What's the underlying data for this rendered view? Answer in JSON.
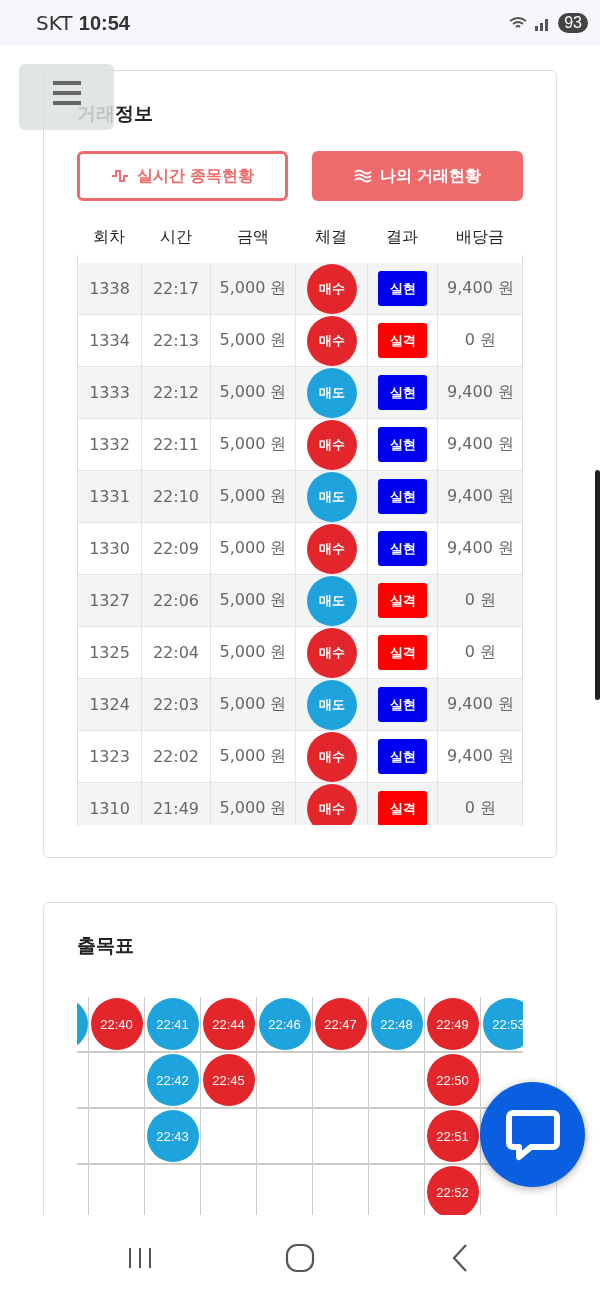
{
  "status_bar": {
    "carrier": "SKT",
    "time": "10:54",
    "battery": "93"
  },
  "trade_card": {
    "title": "거래정보",
    "tabs": [
      {
        "label": "실시간 종목현황",
        "selected": false
      },
      {
        "label": "나의 거래현황",
        "selected": true
      }
    ],
    "columns": [
      "회차",
      "시간",
      "금액",
      "체결",
      "결과",
      "배당금"
    ],
    "rows": [
      {
        "round": "1338",
        "time": "22:17",
        "amount": "5,000 원",
        "side": {
          "label": "매수",
          "color": "#e3262b"
        },
        "result": {
          "label": "실현",
          "color": "#0000f0"
        },
        "payout": "9,400 원"
      },
      {
        "round": "1334",
        "time": "22:13",
        "amount": "5,000 원",
        "side": {
          "label": "매수",
          "color": "#e3262b"
        },
        "result": {
          "label": "실격",
          "color": "#ff0000"
        },
        "payout": "0 원"
      },
      {
        "round": "1333",
        "time": "22:12",
        "amount": "5,000 원",
        "side": {
          "label": "매도",
          "color": "#1fa3dc"
        },
        "result": {
          "label": "실현",
          "color": "#0000f0"
        },
        "payout": "9,400 원"
      },
      {
        "round": "1332",
        "time": "22:11",
        "amount": "5,000 원",
        "side": {
          "label": "매수",
          "color": "#e3262b"
        },
        "result": {
          "label": "실현",
          "color": "#0000f0"
        },
        "payout": "9,400 원"
      },
      {
        "round": "1331",
        "time": "22:10",
        "amount": "5,000 원",
        "side": {
          "label": "매도",
          "color": "#1fa3dc"
        },
        "result": {
          "label": "실현",
          "color": "#0000f0"
        },
        "payout": "9,400 원"
      },
      {
        "round": "1330",
        "time": "22:09",
        "amount": "5,000 원",
        "side": {
          "label": "매수",
          "color": "#e3262b"
        },
        "result": {
          "label": "실현",
          "color": "#0000f0"
        },
        "payout": "9,400 원"
      },
      {
        "round": "1327",
        "time": "22:06",
        "amount": "5,000 원",
        "side": {
          "label": "매도",
          "color": "#1fa3dc"
        },
        "result": {
          "label": "실격",
          "color": "#ff0000"
        },
        "payout": "0 원"
      },
      {
        "round": "1325",
        "time": "22:04",
        "amount": "5,000 원",
        "side": {
          "label": "매수",
          "color": "#e3262b"
        },
        "result": {
          "label": "실격",
          "color": "#ff0000"
        },
        "payout": "0 원"
      },
      {
        "round": "1324",
        "time": "22:03",
        "amount": "5,000 원",
        "side": {
          "label": "매도",
          "color": "#1fa3dc"
        },
        "result": {
          "label": "실현",
          "color": "#0000f0"
        },
        "payout": "9,400 원"
      },
      {
        "round": "1323",
        "time": "22:02",
        "amount": "5,000 원",
        "side": {
          "label": "매수",
          "color": "#e3262b"
        },
        "result": {
          "label": "실현",
          "color": "#0000f0"
        },
        "payout": "9,400 원"
      },
      {
        "round": "1310",
        "time": "21:49",
        "amount": "5,000 원",
        "side": {
          "label": "매수",
          "color": "#e3262b"
        },
        "result": {
          "label": "실격",
          "color": "#ff0000"
        },
        "payout": "0 원"
      }
    ]
  },
  "board_card": {
    "title": "출목표",
    "columns": [
      {
        "marks": [
          {
            "color": "#1fa3dc"
          }
        ]
      },
      {
        "marks": [
          {
            "color": "#e3262b",
            "time": "22:40"
          }
        ]
      },
      {
        "marks": [
          {
            "color": "#1fa3dc",
            "time": "22:41"
          },
          {
            "color": "#1fa3dc",
            "time": "22:42"
          },
          {
            "color": "#1fa3dc",
            "time": "22:43"
          }
        ]
      },
      {
        "marks": [
          {
            "color": "#e3262b",
            "time": "22:44"
          },
          {
            "color": "#e3262b",
            "time": "22:45"
          }
        ]
      },
      {
        "marks": [
          {
            "color": "#1fa3dc",
            "time": "22:46"
          }
        ]
      },
      {
        "marks": [
          {
            "color": "#e3262b",
            "time": "22:47"
          }
        ]
      },
      {
        "marks": [
          {
            "color": "#1fa3dc",
            "time": "22:48"
          }
        ]
      },
      {
        "marks": [
          {
            "color": "#e3262b",
            "time": "22:49"
          },
          {
            "color": "#e3262b",
            "time": "22:50"
          },
          {
            "color": "#e3262b",
            "time": "22:51"
          },
          {
            "color": "#e3262b",
            "time": "22:52"
          }
        ]
      },
      {
        "marks": [
          {
            "color": "#1fa3dc",
            "time": "22:53"
          }
        ]
      }
    ]
  }
}
